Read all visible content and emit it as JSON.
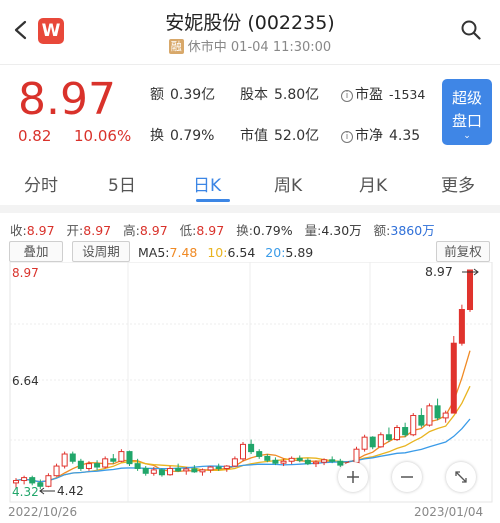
{
  "header": {
    "app_badge": "W",
    "title": "安妮股份 (002235)",
    "rong": "融",
    "status": "休市中 01-04 11:30:00"
  },
  "quote": {
    "price": "8.97",
    "change_abs": "0.82",
    "change_pct": "10.06%",
    "stats": {
      "amount_label": "额",
      "amount_value": "0.39亿",
      "shares_label": "股本",
      "shares_value": "5.80亿",
      "pe_label": "市盈",
      "pe_value": "-1534",
      "turnover_label": "换",
      "turnover_value": "0.79%",
      "mcap_label": "市值",
      "mcap_value": "52.0亿",
      "pb_label": "市净",
      "pb_value": "4.35"
    },
    "super_button_l1": "超级",
    "super_button_l2": "盘口"
  },
  "tabs": [
    {
      "label": "分时"
    },
    {
      "label": "5日"
    },
    {
      "label": "日K"
    },
    {
      "label": "周K"
    },
    {
      "label": "月K"
    },
    {
      "label": "更多"
    }
  ],
  "ohlc": {
    "close_label": "收:",
    "close": "8.97",
    "open_label": "开:",
    "open": "8.97",
    "high_label": "高:",
    "high": "8.97",
    "low_label": "低:",
    "low": "8.97",
    "turn_label": "换:",
    "turn": "0.79%",
    "vol_label": "量:",
    "vol": "4.30万",
    "amt_label": "额:",
    "amt": "3860万"
  },
  "indicators": {
    "overlay_btn": "叠加",
    "period_btn": "设周期",
    "ma5_label": "MA5:",
    "ma5": "7.48",
    "ma10_label": "10:",
    "ma10": "6.54",
    "ma20_label": "20:",
    "ma20": "5.89",
    "adjust_btn": "前复权"
  },
  "chart": {
    "y_top_label": "8.97",
    "y_mid_label": "6.64",
    "y_low_label": "4.32",
    "high_marker": "8.97",
    "low_marker": "4.42",
    "start_date": "2022/10/26",
    "end_date": "2023/01/04",
    "colors": {
      "up": "#e0332d",
      "down": "#21a66a",
      "ma5": "#f08a24",
      "ma10": "#e9b420",
      "ma20": "#3a9be8"
    }
  },
  "chart_data": {
    "type": "candlestick",
    "x": [
      "2022/10/26",
      "2023/01/04"
    ],
    "ylim": [
      4.32,
      8.97
    ],
    "ohlc": [
      [
        4.55,
        4.65,
        4.45,
        4.6
      ],
      [
        4.6,
        4.7,
        4.52,
        4.66
      ],
      [
        4.66,
        4.7,
        4.5,
        4.55
      ],
      [
        4.55,
        4.62,
        4.42,
        4.48
      ],
      [
        4.48,
        4.75,
        4.46,
        4.7
      ],
      [
        4.7,
        4.95,
        4.68,
        4.9
      ],
      [
        4.9,
        5.2,
        4.85,
        5.15
      ],
      [
        5.15,
        5.2,
        4.95,
        5.0
      ],
      [
        5.0,
        5.05,
        4.8,
        4.85
      ],
      [
        4.85,
        5.0,
        4.8,
        4.95
      ],
      [
        4.95,
        5.02,
        4.82,
        4.88
      ],
      [
        4.88,
        5.1,
        4.85,
        5.05
      ],
      [
        5.05,
        5.15,
        4.95,
        5.0
      ],
      [
        5.0,
        5.25,
        4.98,
        5.2
      ],
      [
        5.2,
        5.22,
        4.9,
        4.95
      ],
      [
        4.95,
        5.05,
        4.8,
        4.85
      ],
      [
        4.85,
        4.9,
        4.7,
        4.75
      ],
      [
        4.75,
        4.88,
        4.7,
        4.82
      ],
      [
        4.82,
        4.85,
        4.68,
        4.72
      ],
      [
        4.72,
        4.9,
        4.7,
        4.85
      ],
      [
        4.85,
        4.95,
        4.78,
        4.8
      ],
      [
        4.8,
        4.88,
        4.72,
        4.84
      ],
      [
        4.84,
        4.92,
        4.76,
        4.78
      ],
      [
        4.78,
        4.85,
        4.7,
        4.82
      ],
      [
        4.82,
        4.9,
        4.76,
        4.88
      ],
      [
        4.88,
        4.95,
        4.8,
        4.85
      ],
      [
        4.85,
        4.92,
        4.78,
        4.9
      ],
      [
        4.9,
        5.1,
        4.88,
        5.05
      ],
      [
        5.05,
        5.4,
        5.0,
        5.35
      ],
      [
        5.35,
        5.45,
        5.15,
        5.2
      ],
      [
        5.2,
        5.25,
        5.05,
        5.1
      ],
      [
        5.1,
        5.15,
        4.98,
        5.02
      ],
      [
        5.02,
        5.08,
        4.92,
        4.96
      ],
      [
        4.96,
        5.05,
        4.9,
        5.0
      ],
      [
        5.0,
        5.1,
        4.94,
        5.06
      ],
      [
        5.06,
        5.12,
        4.98,
        5.02
      ],
      [
        5.02,
        5.06,
        4.92,
        4.95
      ],
      [
        4.95,
        5.02,
        4.88,
        4.98
      ],
      [
        4.98,
        5.06,
        4.92,
        5.03
      ],
      [
        5.03,
        5.1,
        4.96,
        5.0
      ],
      [
        5.0,
        5.05,
        4.88,
        4.92
      ],
      [
        4.92,
        5.0,
        4.85,
        4.97
      ],
      [
        4.97,
        5.3,
        4.95,
        5.25
      ],
      [
        5.25,
        5.55,
        5.2,
        5.5
      ],
      [
        5.5,
        5.52,
        5.25,
        5.3
      ],
      [
        5.3,
        5.6,
        5.28,
        5.55
      ],
      [
        5.55,
        5.7,
        5.4,
        5.45
      ],
      [
        5.45,
        5.75,
        5.42,
        5.7
      ],
      [
        5.7,
        5.8,
        5.5,
        5.55
      ],
      [
        5.55,
        6.0,
        5.52,
        5.95
      ],
      [
        5.95,
        6.1,
        5.7,
        5.75
      ],
      [
        5.75,
        6.2,
        5.72,
        6.15
      ],
      [
        6.15,
        6.3,
        5.85,
        5.9
      ],
      [
        5.9,
        6.05,
        5.8,
        6.0
      ],
      [
        6.0,
        7.6,
        6.0,
        7.45
      ],
      [
        7.45,
        8.25,
        7.4,
        8.15
      ],
      [
        8.15,
        8.97,
        8.1,
        8.97
      ]
    ]
  }
}
